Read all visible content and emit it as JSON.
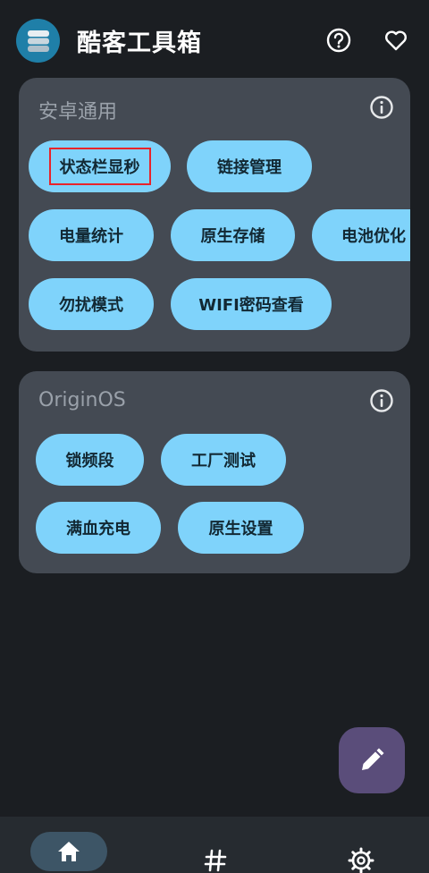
{
  "header": {
    "title": "酷客工具箱",
    "logo_icon": "stack-layers-icon",
    "help_icon": "help-circle-icon",
    "favorite_icon": "heart-outline-icon"
  },
  "sections": [
    {
      "title": "安卓通用",
      "info_icon": "info-circle-icon",
      "items": [
        "状态栏显秒",
        "链接管理",
        "电量统计",
        "原生存储",
        "电池优化",
        "勿扰模式",
        "WIFI密码查看"
      ]
    },
    {
      "title": "OriginOS",
      "info_icon": "info-circle-icon",
      "items": [
        "锁频段",
        "工厂测试",
        "满血充电",
        "原生设置"
      ]
    }
  ],
  "fab": {
    "icon": "pencil-icon"
  },
  "bottom_nav": {
    "items": [
      {
        "icon": "home-icon",
        "active": true
      },
      {
        "icon": "hashtag-icon",
        "active": false
      },
      {
        "icon": "gear-icon",
        "active": false
      }
    ]
  },
  "colors": {
    "background": "#1b1e22",
    "card": "#444a53",
    "chip": "#7fd3fb",
    "chip_text": "#122833",
    "fab": "#5a4d7a",
    "highlight_box": "#e8232a"
  }
}
